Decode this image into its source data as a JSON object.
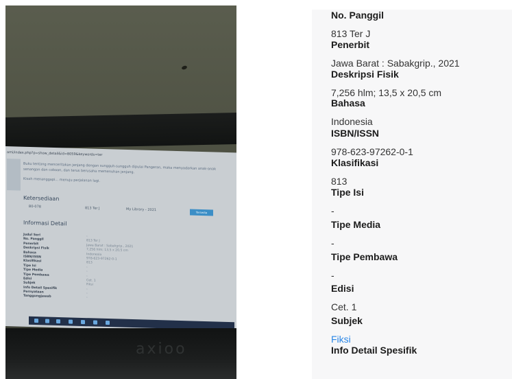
{
  "photo": {
    "screen": {
      "url": "ami/index.php?p=show_detail&id=8059&keywords=ter",
      "synopsis_1": "Buku tentang menceritakan jenjang dengan sungguh-sungguh dipulai Pangeran, maka menyadarkan anak-anak",
      "synopsis_2": "senangan dan cobaan, dan terus berusaha memenuhan jenjang.",
      "synopsis_3": "Kisah menanggapi... menuju perjalanan lagi.",
      "availability_heading": "Ketersediaan",
      "availability": {
        "code": "B0-078",
        "call_number": "813 Ter J",
        "location": "My Library - 2021",
        "button": "Tersedia"
      },
      "info_heading": "Informasi Detail",
      "rows": [
        {
          "k": "Judul Seri",
          "v": "-"
        },
        {
          "k": "No. Panggil",
          "v": "813 Ter J"
        },
        {
          "k": "Penerbit",
          "v": "Jawa Barat : Sabakgrip., 2021"
        },
        {
          "k": "Deskripsi Fisik",
          "v": "7,256 hlm; 13,5 x 20,5 cm"
        },
        {
          "k": "Bahasa",
          "v": "Indonesia"
        },
        {
          "k": "ISBN/ISSN",
          "v": "978-623-97262-0-1"
        },
        {
          "k": "Klasifikasi",
          "v": "813"
        },
        {
          "k": "Tipe Isi",
          "v": "-"
        },
        {
          "k": "Tipe Media",
          "v": "-"
        },
        {
          "k": "Tipe Pembawa",
          "v": "-"
        },
        {
          "k": "Edisi",
          "v": "Cet. 1"
        },
        {
          "k": "Subjek",
          "v": "Fiksi"
        },
        {
          "k": "Info Detail Spesifik",
          "v": "-"
        },
        {
          "k": "Pernyataan",
          "v": "-"
        },
        {
          "k": "Tanggungjawab",
          "v": "-"
        }
      ]
    },
    "brand": "axioo"
  },
  "detail": {
    "fields": [
      {
        "label": "No. Panggil",
        "value": "813 Ter J"
      },
      {
        "label": "Penerbit",
        "value": "Jawa Barat : Sabakgrip., 2021"
      },
      {
        "label": "Deskripsi Fisik",
        "value": "7,256 hlm; 13,5 x 20,5 cm"
      },
      {
        "label": "Bahasa",
        "value": "Indonesia"
      },
      {
        "label": "ISBN/ISSN",
        "value": "978-623-97262-0-1"
      },
      {
        "label": "Klasifikasi",
        "value": "813"
      },
      {
        "label": "Tipe Isi",
        "value": "-"
      },
      {
        "label": "Tipe Media",
        "value": "-"
      },
      {
        "label": "Tipe Pembawa",
        "value": "-"
      },
      {
        "label": "Edisi",
        "value": "Cet. 1"
      },
      {
        "label": "Subjek",
        "value": "Fiksi"
      },
      {
        "label": "Info Detail Spesifik",
        "value": ""
      }
    ],
    "link_color": "#2a86e6"
  }
}
